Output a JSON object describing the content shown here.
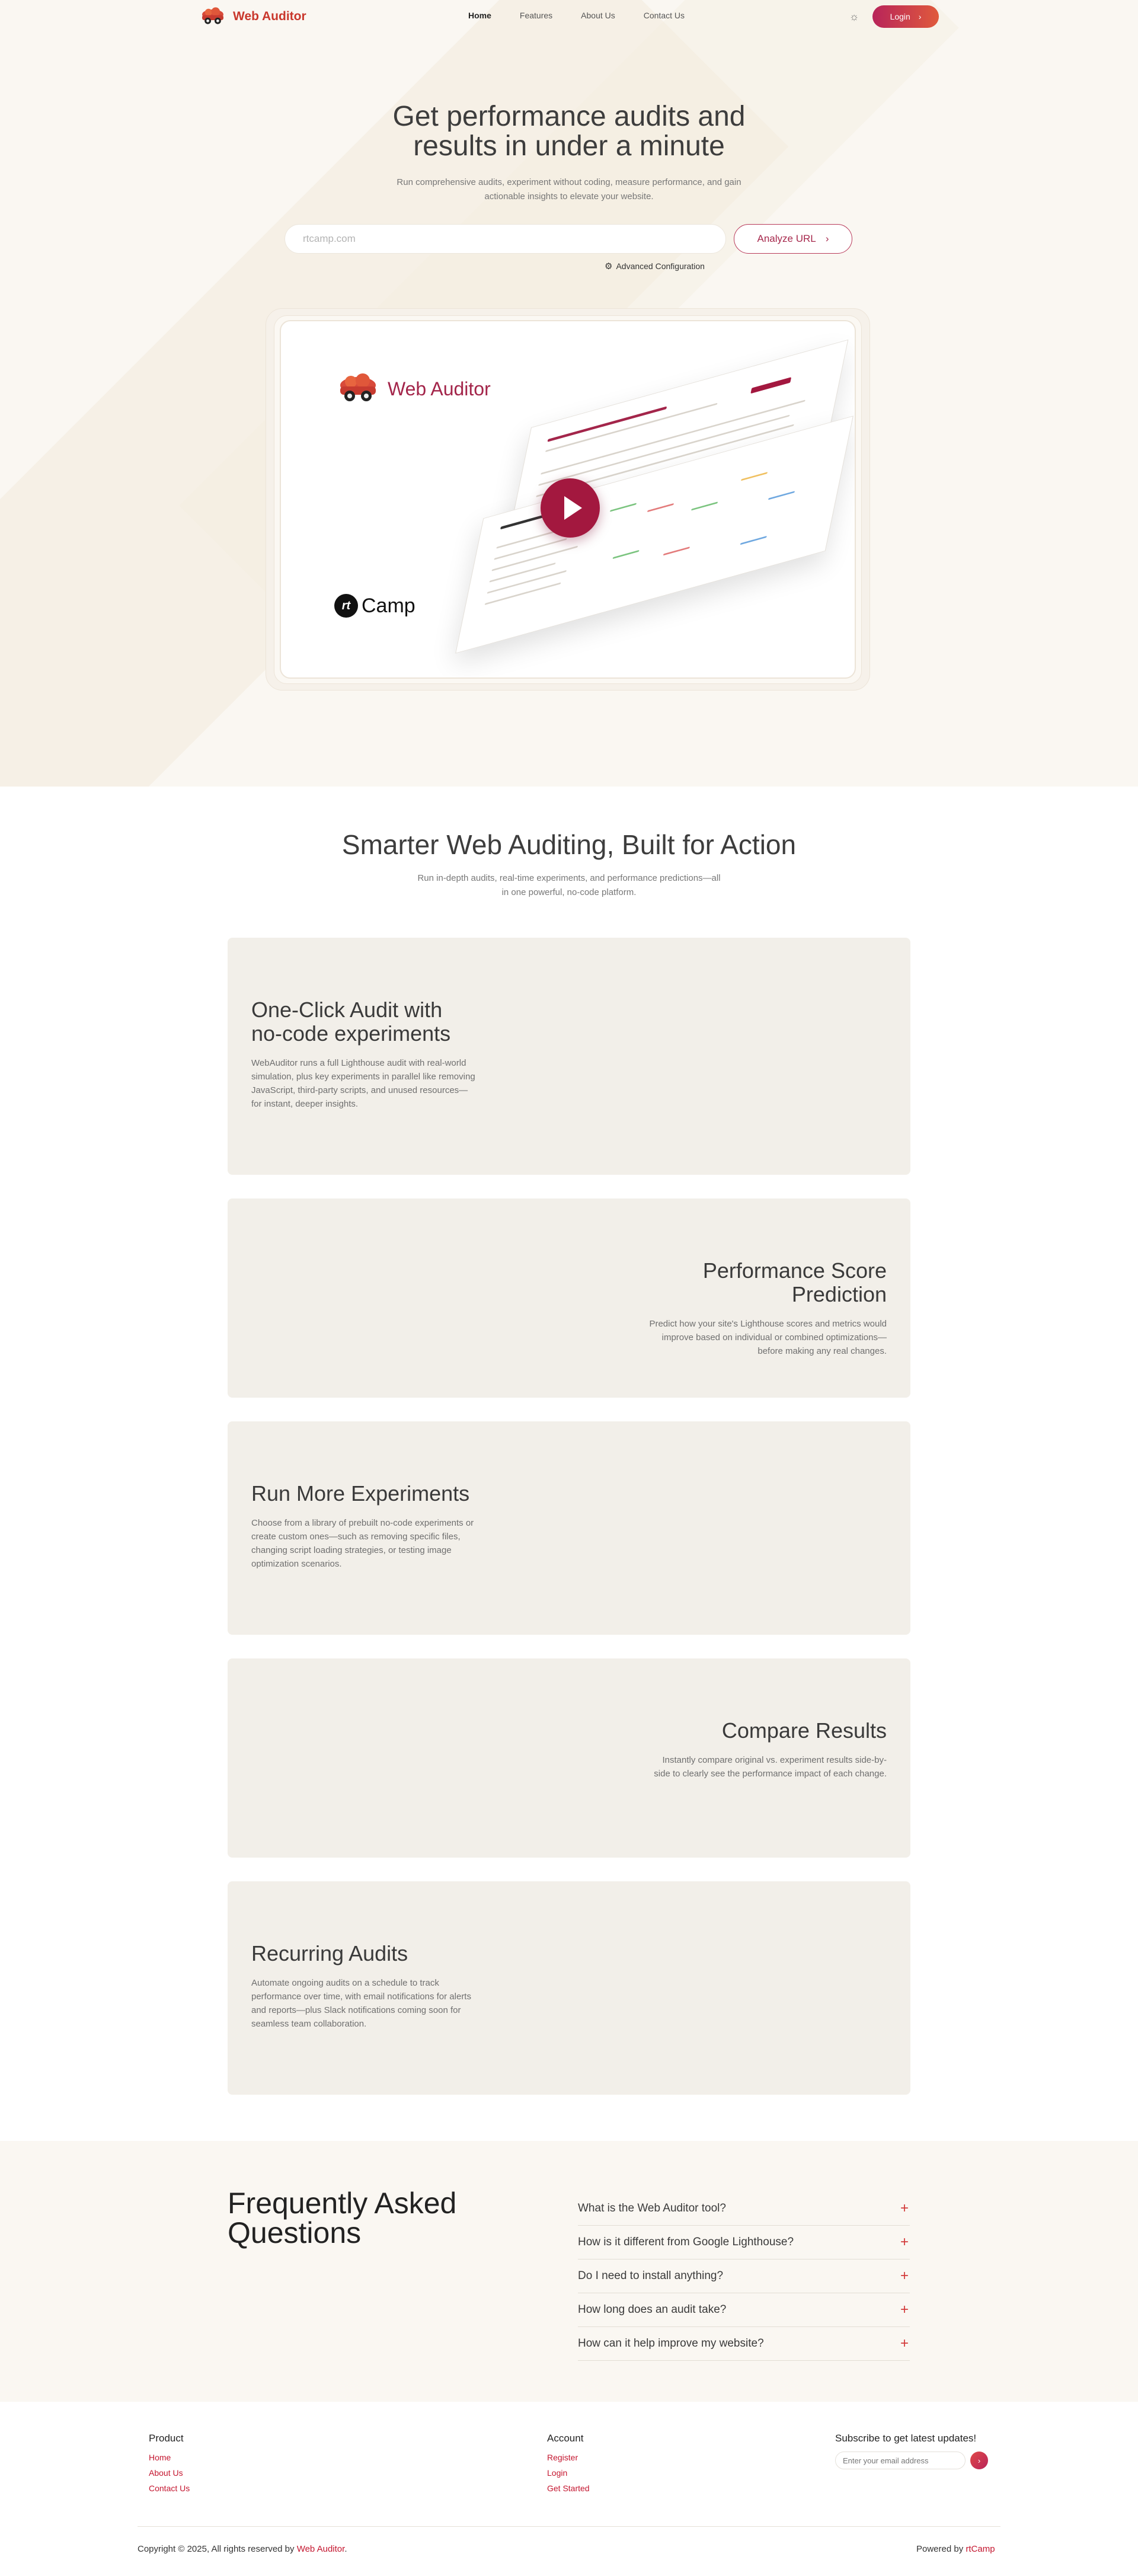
{
  "header": {
    "brand": "Web Auditor",
    "nav": [
      {
        "label": "Home",
        "active": true
      },
      {
        "label": "Features",
        "active": false
      },
      {
        "label": "About Us",
        "active": false
      },
      {
        "label": "Contact Us",
        "active": false
      }
    ],
    "login_label": "Login"
  },
  "hero": {
    "title_line1": "Get performance audits and",
    "title_line2": "results in under a minute",
    "subtitle": "Run comprehensive audits, experiment without coding, measure performance, and gain actionable insights to elevate your website.",
    "url_placeholder": "rtcamp.com",
    "analyze_label": "Analyze URL",
    "advanced_label": "Advanced Configuration",
    "video": {
      "brand": "Web Auditor",
      "partner": "Camp",
      "partner_mark": "rt"
    }
  },
  "features": {
    "title": "Smarter Web Auditing, Built for Action",
    "subtitle": "Run in-depth audits, real-time experiments, and performance predictions—all in one powerful, no-code platform.",
    "cards": [
      {
        "title": "One-Click Audit with no-code experiments",
        "description": "WebAuditor runs a full Lighthouse audit with real-world simulation, plus key experiments in parallel like removing JavaScript, third-party scripts, and unused resources—for instant, deeper insights."
      },
      {
        "title": "Performance Score Prediction",
        "description": "Predict how your site's Lighthouse scores and metrics would improve based on individual or combined optimizations—before making any real changes."
      },
      {
        "title": "Run More Experiments",
        "description": "Choose from a library of prebuilt no-code experiments or create custom ones—such as removing specific files, changing script loading strategies, or testing image optimization scenarios."
      },
      {
        "title": "Compare Results",
        "description": "Instantly compare original vs. experiment results side-by-side to clearly see the performance impact of each change."
      },
      {
        "title": "Recurring Audits",
        "description": "Automate ongoing audits on a schedule to track performance over time, with email notifications for alerts and reports—plus Slack notifications coming soon for seamless team collaboration."
      }
    ]
  },
  "faq": {
    "title_line1": "Frequently Asked",
    "title_line2": "Questions",
    "items": [
      "What is the Web Auditor tool?",
      "How is it different from Google Lighthouse?",
      "Do I need to install anything?",
      "How long does an audit take?",
      "How can it help improve my website?"
    ]
  },
  "footer": {
    "product": {
      "title": "Product",
      "links": [
        "Home",
        "About Us",
        "Contact Us"
      ]
    },
    "account": {
      "title": "Account",
      "links": [
        "Register",
        "Login",
        "Get Started"
      ]
    },
    "subscribe": {
      "title": "Subscribe to get latest updates!",
      "placeholder": "Enter your email address"
    },
    "copyright_prefix": "Copyright © 2025, All rights reserved by",
    "copyright_brand": "Web Auditor",
    "copyright_suffix": ".",
    "powered_prefix": "Powered by",
    "powered_brand": "rtCamp"
  },
  "colors": {
    "accent": "#c4162f",
    "brand": "#c9372c",
    "hero_bg": "#faf7f2",
    "card_bg": "#f2efe9"
  }
}
